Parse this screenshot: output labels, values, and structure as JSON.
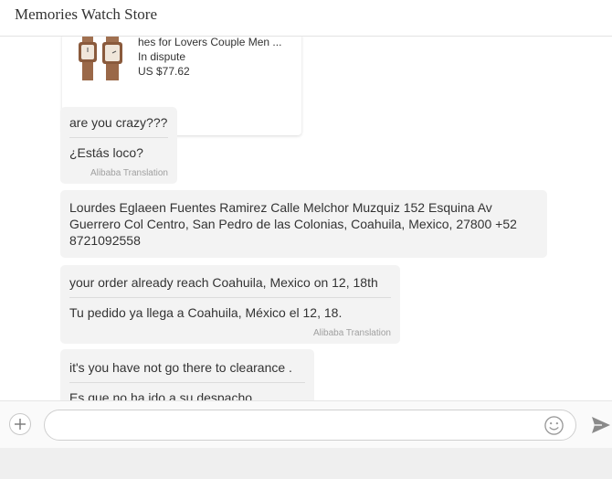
{
  "header": {
    "title": "Memories Watch Store"
  },
  "product": {
    "name": "hes for Lovers Couple Men ...",
    "status": "In dispute",
    "price": "US $77.62"
  },
  "messages": [
    {
      "original": "are you crazy???",
      "translation": "¿Estás loco?",
      "credit": "Alibaba Translation"
    },
    {
      "original": "Lourdes Eglaeen Fuentes Ramirez Calle Melchor Muzquiz 152 Esquina Av Guerrero Col Centro, San Pedro de las Colonias, Coahuila, Mexico, 27800 +52 8721092558"
    },
    {
      "original": "your order already reach  Coahuila, Mexico  on 12, 18th",
      "translation": "Tu pedido ya llega a Coahuila, México el 12, 18.",
      "credit": "Alibaba Translation"
    },
    {
      "original": "it's you have not go there   to clearance .",
      "translation": "Es que no ha ido a su despacho."
    }
  ],
  "composer": {
    "placeholder": ""
  },
  "icons": {
    "add": "plus-icon",
    "emoji": "smiley-icon",
    "send": "paper-plane-icon"
  }
}
